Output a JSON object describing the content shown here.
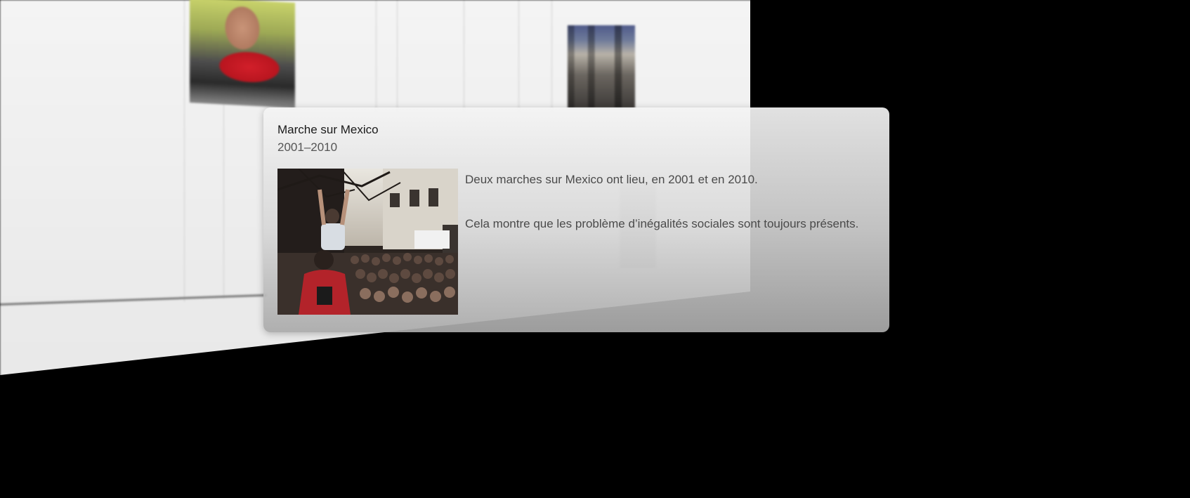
{
  "popup": {
    "title": "Marche sur Mexico",
    "date_range": "2001–2010",
    "paragraphs": [
      "Deux marches sur Mexico ont lieu, en 2001 et en 2010.",
      "Cela montre que les problème d’inégalités sociales sont toujours présents."
    ],
    "image": {
      "icon": "protest-crowd-photo"
    }
  },
  "background_timeline": {
    "images": [
      {
        "icon": "portrait-red-shirt-photo"
      },
      {
        "icon": "crowd-balcony-photo"
      }
    ]
  },
  "colors": {
    "page_background": "#000000",
    "card_title": "#1a1a1a",
    "card_text": "#4a4a4a"
  }
}
